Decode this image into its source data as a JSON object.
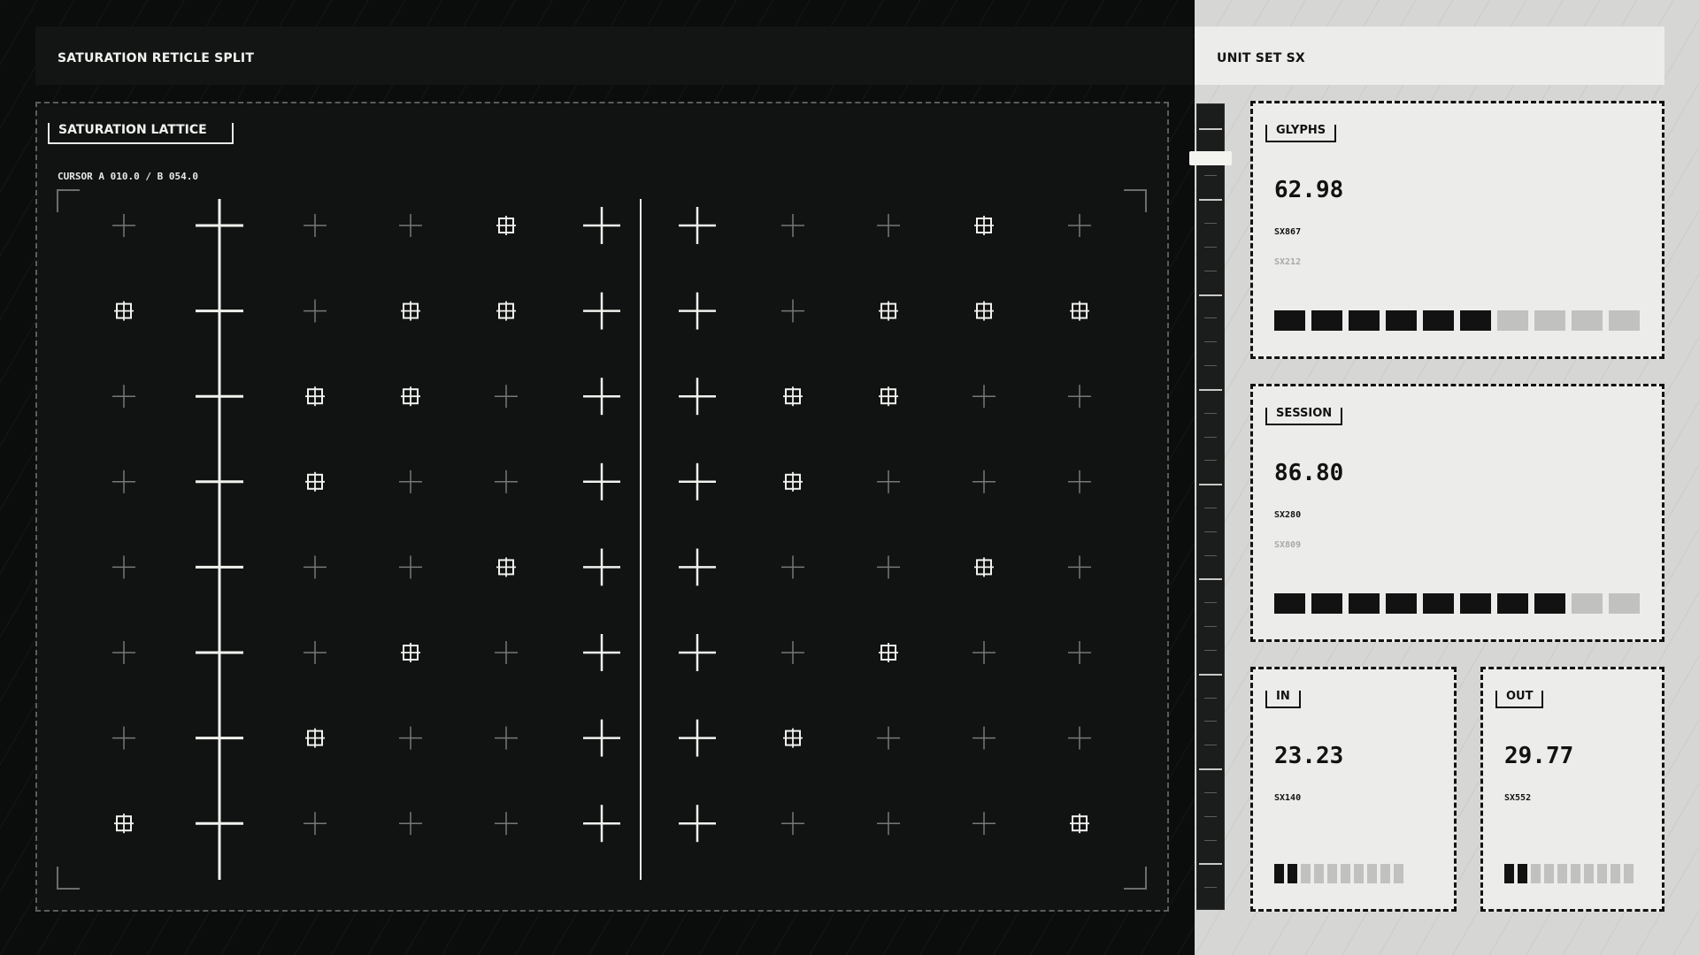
{
  "header": {
    "left_title": "SATURATION RETICLE SPLIT",
    "right_title": "UNIT SET SX"
  },
  "lattice": {
    "title": "SATURATION LATTICE",
    "cursor": "CURSOR A 010.0 / B 054.0",
    "columns": 11,
    "rows": 8,
    "cursor_a_column": 1,
    "cursor_b_column": 5,
    "boxed_cells": [
      [
        0,
        4
      ],
      [
        0,
        9
      ],
      [
        1,
        0
      ],
      [
        1,
        3
      ],
      [
        1,
        4
      ],
      [
        1,
        8
      ],
      [
        1,
        9
      ],
      [
        1,
        10
      ],
      [
        2,
        2
      ],
      [
        2,
        3
      ],
      [
        2,
        7
      ],
      [
        2,
        8
      ],
      [
        3,
        2
      ],
      [
        3,
        7
      ],
      [
        4,
        4
      ],
      [
        4,
        9
      ],
      [
        5,
        3
      ],
      [
        5,
        8
      ],
      [
        6,
        2
      ],
      [
        6,
        7
      ],
      [
        7,
        0
      ],
      [
        7,
        10
      ]
    ]
  },
  "cards": [
    {
      "label": "GLYPHS",
      "value": "62.98",
      "code": "SX867",
      "code_secondary": "SX212",
      "segments_on": 6,
      "segments_total": 10
    },
    {
      "label": "SESSION",
      "value": "86.80",
      "code": "SX280",
      "code_secondary": "SX809",
      "segments_on": 8,
      "segments_total": 10
    },
    {
      "label": "IN",
      "value": "23.23",
      "code": "SX140",
      "code_secondary": "",
      "segments_on": 2,
      "segments_total": 10
    },
    {
      "label": "OUT",
      "value": "29.77",
      "code": "SX552",
      "code_secondary": "",
      "segments_on": 2,
      "segments_total": 10
    }
  ],
  "colors": {
    "dark_bg": "#0b0c0c",
    "panel_bg": "#111312",
    "light_bg": "#d6d7d4",
    "card_bg": "#ecedea",
    "ink": "#111211",
    "reticle": "#f1f1ee",
    "reticle_dim": "#777977"
  }
}
